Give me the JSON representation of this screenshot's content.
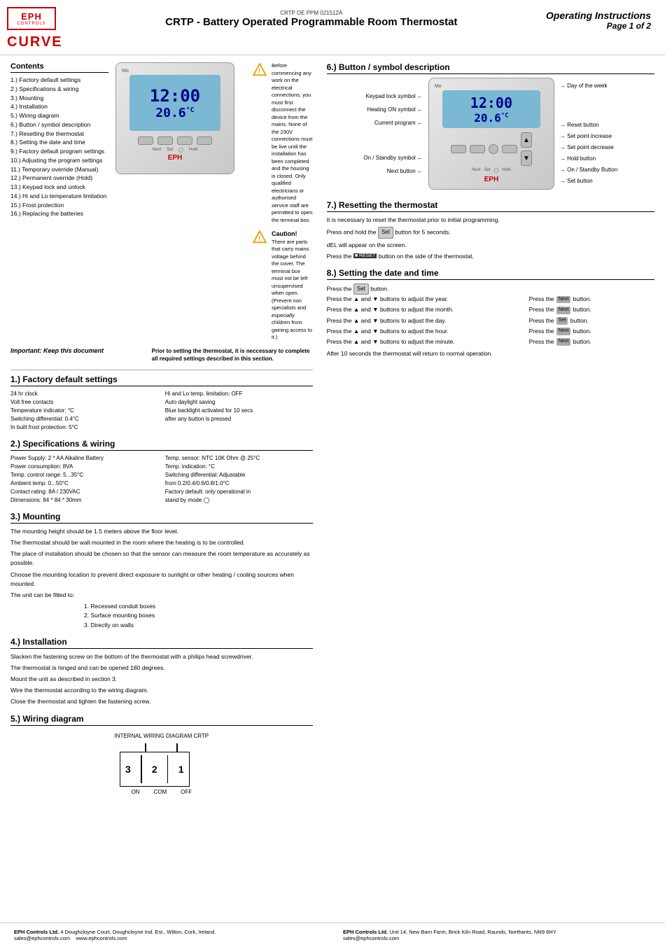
{
  "header": {
    "doc_num": "CRTP OE PPM 021512A",
    "title": "CRTP - Battery Operated Programmable Room Thermostat",
    "operating_label": "Operating Instructions",
    "page_label": "Page 1 of 2",
    "logo_name": "EPH",
    "logo_sub": "CONTROLS",
    "logo_curve": "CURVE"
  },
  "warning": {
    "text": "Before commencing any work on the electrical connections, you must first disconnect the device from the mains. None of the 230V connections must be live until the installation has been completed and the housing is closed. Only qualified electricians or authorised service staff are permitted to open the terminal box.",
    "caution_title": "Caution!",
    "caution_text": "There are parts that carry mains voltage behind the cover. The terminal box must not be left unsupervised when open. (Prevent non specialists and especially children from gaining access to it.)"
  },
  "thermostat_display": {
    "time": "12:00",
    "temp": "20.6°C",
    "day": "Mo"
  },
  "important": {
    "italic_text": "Important: Keep this document",
    "neccessary_text": "Prior to setting the thermostat, it is neccessary to complete all required settings described in this section."
  },
  "contents": {
    "title": "Contents",
    "items": [
      "1.) Factory default settings",
      "2.) Specifications & wiring",
      "3.) Mounting",
      "4.) Installation",
      "5.) Wiring diagram",
      "6.) Button / symbol description",
      "7.) Resetting the thermostat",
      "8.) Setting the date and time",
      "9.) Factory default program settings",
      "10.) Adjusting the program settings",
      "11.) Temporary override (Manual)",
      "12.) Permanent override (Hold)",
      "13.) Keypad lock and unlock",
      "14.) Hi and Lo temperature limitation",
      "15.) Frost protection",
      "16.) Replacing the batteries"
    ]
  },
  "section1": {
    "title": "1.) Factory default settings",
    "left_items": [
      "24 hr clock",
      "Volt free contacts",
      "Temperature indicator: °C",
      "Switching differential: 0.4°C",
      "In built frost protection: 5°C"
    ],
    "right_items": [
      "Hi and Lo temp. limitation: OFF",
      "Auto daylight saving",
      "Blue backlight activated for 10 secs",
      "after any button is pressed"
    ]
  },
  "section2": {
    "title": "2.) Specifications & wiring",
    "left_items": [
      "Power Supply: 2 * AA Alkaline Battery",
      "Power consumption: 8VA",
      "Temp. control range: 5...35°C",
      "Ambient temp: 0...50°C",
      "Contact rating: 8A / 230VAC",
      "Dimensions: 84 * 84 * 30mm"
    ],
    "right_items": [
      "Temp. sensor: NTC 10K Ohm @ 25°C",
      "Temp. indication: °C",
      "Switching differential: Adjustable",
      "from 0.2/0.4/0.6/0.8/1.0°C",
      "Factory default: only operational in",
      "stand by mode"
    ]
  },
  "section3": {
    "title": "3.) Mounting",
    "paragraphs": [
      "The mounting height should be 1.5 meters above the floor level.",
      "The thermostat should be wall mounted in the room where the heating is to be controlled.",
      "The place of installation should be chosen so that the sensor can measure the room temperature as accurately as possible.",
      "Choose the mounting location to prevent direct exposure to sunlight or other heating / cooling sources when mounted.",
      "The unit can be fitted to:"
    ],
    "mount_options": [
      "1. Recessed conduit boxes",
      "2. Surface mounting boxes",
      "3. Directly on walls"
    ]
  },
  "section4": {
    "title": "4.) Installation",
    "paragraphs": [
      "Slacken the fastening screw on the bottom of the thermostat with a philips head screwdriver.",
      "The thermostat is hinged and can be opened 180 degrees.",
      "Mount the unit as described in section 3.",
      "Wire the thermostat according to the wiring diagram.",
      "Close the thermostat and tighten the fastening screw."
    ]
  },
  "section5": {
    "title": "5.) Wiring diagram",
    "diagram_label": "INTERNAL WIRING DIAGRAM CRTP",
    "terminals": [
      "3",
      "2",
      "1"
    ],
    "terminal_labels": [
      "ON",
      "COM",
      "OFF"
    ]
  },
  "section6": {
    "title": "6.) Button / symbol description",
    "labels_left": [
      "Keypad lock symbol",
      "Heating ON symbol",
      "Current program",
      "On / Standby symbol",
      "Next button"
    ],
    "labels_right": [
      "Day of the week",
      "Reset button",
      "Set point increase",
      "Set point decrease",
      "Hold button",
      "On / Standby Button",
      "Set button"
    ]
  },
  "section7": {
    "title": "7.) Resetting the thermostat",
    "paragraphs": [
      "It is necessary to reset the thermostat prior to initial programming.",
      "Press and hold the  button for 5 seconds.",
      "dEL will appear on the screen.",
      "Press the  RESET  button on the side of the thermostat."
    ]
  },
  "section8": {
    "title": "8.) Setting the date and time",
    "intro": "Press the  button.",
    "rows": [
      {
        "left": "Press the ▲ and ▼ buttons to adjust the year.",
        "right": "Press the Next button."
      },
      {
        "left": "Press the ▲ and ▼ buttons to adjust the month.",
        "right": "Press the Next button."
      },
      {
        "left": "Press the ▲ and ▼ buttons to adjust the day.",
        "right": "Press the Set button."
      },
      {
        "left": "Press the ▲ and ▼ buttons to adjust the hour.",
        "right": "Press the Next button."
      },
      {
        "left": "Press the ▲ and ▼ buttons to adjust the minute.",
        "right": "Press the Next button."
      }
    ],
    "outro": "After 10 seconds the thermostat will return to normal operation."
  },
  "footer": {
    "left_company": "EPH Controls Ltd.",
    "left_address": "4 Doughcloyne Court, Doughcloyne Ind. Est., Wilton, Cork, Ireland.",
    "left_email": "sales@ephcontrols.com",
    "left_web": "www.ephcontrols.com",
    "right_company": "EPH Controls Ltd.",
    "right_address": "Unit 14, New Barn Farm, Brick Kiln Road, Raunds, Northants, NN9 6HY",
    "right_email": "sales@ephcontrols.com"
  }
}
